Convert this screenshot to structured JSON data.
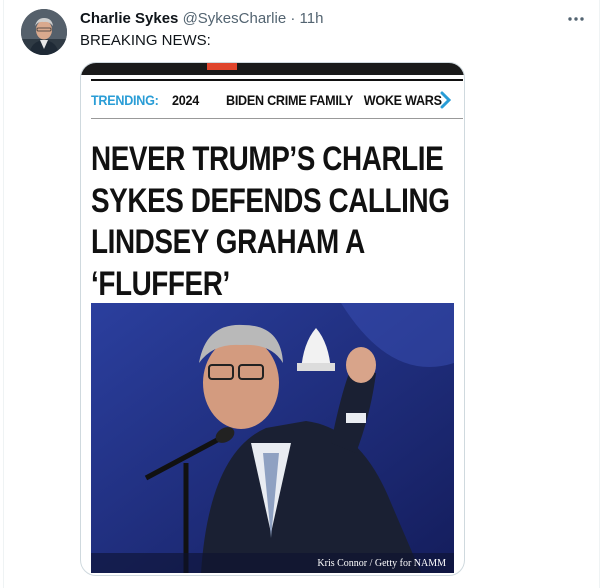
{
  "tweet": {
    "display_name": "Charlie Sykes",
    "handle": "@SykesCharlie",
    "separator": "·",
    "time": "11h",
    "text": "BREAKING NEWS:",
    "more_icon": "more-horizontal-icon"
  },
  "article": {
    "trending_label": "TRENDING:",
    "trending_items": [
      "2024",
      "BIDEN CRIME FAMILY",
      "WOKE WARS"
    ],
    "chevron_icon": "chevron-right-icon",
    "headline_lines": [
      "NEVER TRUMP’S CHARLIE",
      "SYKES DEFENDS CALLING",
      "LINDSEY GRAHAM A",
      "‘FLUFFER’"
    ],
    "photo_credit": "Kris Connor / Getty for NAMM"
  },
  "colors": {
    "accent_blue": "#2a9dd6",
    "logo_orange": "#e0452c",
    "photo_background": "#1b2a78"
  }
}
